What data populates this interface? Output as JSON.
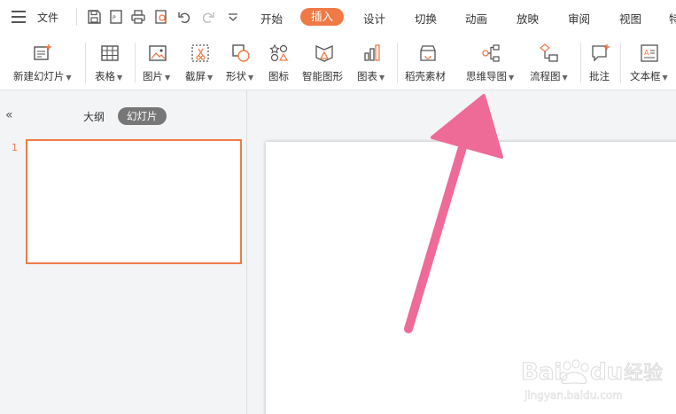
{
  "menubar": {
    "file_label": "文件",
    "tabs": [
      {
        "label": "开始",
        "active": false
      },
      {
        "label": "插入",
        "active": true
      },
      {
        "label": "设计",
        "active": false
      },
      {
        "label": "切换",
        "active": false
      },
      {
        "label": "动画",
        "active": false
      },
      {
        "label": "放映",
        "active": false
      },
      {
        "label": "审阅",
        "active": false
      },
      {
        "label": "视图",
        "active": false
      },
      {
        "label": "特",
        "active": false
      }
    ]
  },
  "ribbon": {
    "items": [
      {
        "label": "新建幻灯片",
        "icon": "new-slide-icon",
        "dropdown": true
      },
      {
        "label": "表格",
        "icon": "table-icon",
        "dropdown": true
      },
      {
        "label": "图片",
        "icon": "picture-icon",
        "dropdown": true
      },
      {
        "label": "截屏",
        "icon": "screenshot-icon",
        "dropdown": true
      },
      {
        "label": "形状",
        "icon": "shape-icon",
        "dropdown": true
      },
      {
        "label": "图标",
        "icon": "icons-icon",
        "dropdown": false
      },
      {
        "label": "智能图形",
        "icon": "smartart-icon",
        "dropdown": false
      },
      {
        "label": "图表",
        "icon": "chart-icon",
        "dropdown": true
      },
      {
        "label": "稻壳素材",
        "icon": "material-icon",
        "dropdown": false
      },
      {
        "label": "思维导图",
        "icon": "mindmap-icon",
        "dropdown": true
      },
      {
        "label": "流程图",
        "icon": "flowchart-icon",
        "dropdown": true
      },
      {
        "label": "批注",
        "icon": "comment-icon",
        "dropdown": false
      },
      {
        "label": "文本框",
        "icon": "textbox-icon",
        "dropdown": true
      }
    ]
  },
  "leftpanel": {
    "outline_tab": "大纲",
    "slides_tab": "幻灯片",
    "slide_number": "1"
  },
  "colors": {
    "accent": "#f07a45",
    "arrow": "#ee6b97"
  }
}
